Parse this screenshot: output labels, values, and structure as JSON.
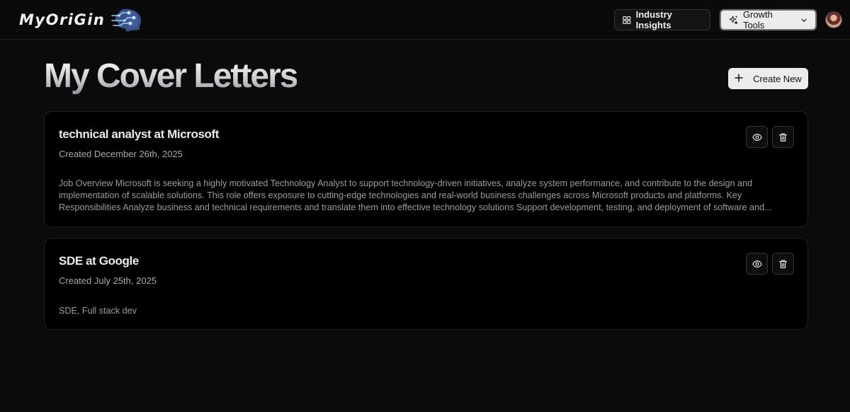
{
  "header": {
    "logo_text": "MyOriGin",
    "nav": {
      "insights_label": "Industry Insights",
      "growth_label": "Growth Tools"
    }
  },
  "main": {
    "title": "My Cover Letters",
    "create_label": "Create New",
    "letters": [
      {
        "title": "technical analyst at Microsoft",
        "created": "Created December 26th, 2025",
        "description": "Job Overview Microsoft is seeking a highly motivated Technology Analyst to support technology-driven initiatives, analyze system performance, and contribute to the design and implementation of scalable solutions. This role offers exposure to cutting-edge technologies and real-world business challenges across Microsoft products and platforms. Key Responsibilities Analyze business and technical requirements and translate them into effective technology solutions Support development, testing, and deployment of software and..."
      },
      {
        "title": "SDE at Google",
        "created": "Created July 25th, 2025",
        "description": "SDE, Full stack dev"
      }
    ]
  },
  "icons": {
    "insights": "grid-icon",
    "growth": "sparkles-icon",
    "dropdown": "chevron-down-icon",
    "create": "plus-icon",
    "view": "eye-icon",
    "delete": "trash-icon"
  },
  "colors": {
    "background": "#0b0b0b",
    "card": "#000000",
    "button_light": "#ececec"
  }
}
